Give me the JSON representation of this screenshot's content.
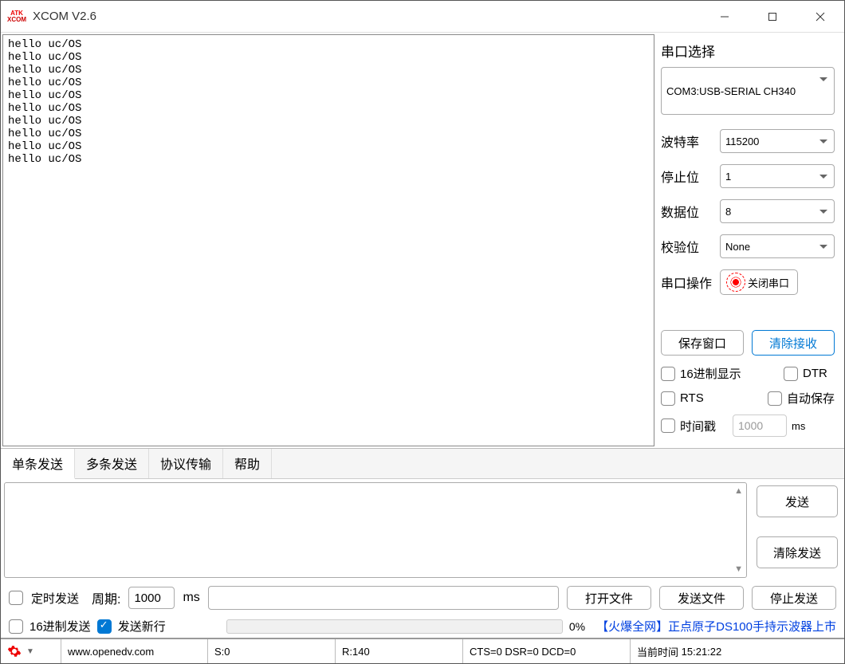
{
  "title": "XCOM V2.6",
  "logo": {
    "line1": "ATK",
    "line2": "XCOM"
  },
  "receive_lines": [
    "hello uc/OS",
    "hello uc/OS",
    "hello uc/OS",
    "hello uc/OS",
    "hello uc/OS",
    "hello uc/OS",
    "hello uc/OS",
    "hello uc/OS",
    "hello uc/OS",
    "hello uc/OS"
  ],
  "side": {
    "port_select_label": "串口选择",
    "port": "COM3:USB-SERIAL CH340",
    "baud_label": "波特率",
    "baud": "115200",
    "stop_label": "停止位",
    "stop": "1",
    "data_label": "数据位",
    "data": "8",
    "parity_label": "校验位",
    "parity": "None",
    "op_label": "串口操作",
    "op_btn": "关闭串口",
    "save_win": "保存窗口",
    "clear_recv": "清除接收",
    "hex_disp": "16进制显示",
    "dtr": "DTR",
    "rts": "RTS",
    "autosave": "自动保存",
    "ts": "时间戳",
    "ts_val": "1000",
    "ts_unit": "ms"
  },
  "tabs": {
    "t1": "单条发送",
    "t2": "多条发送",
    "t3": "协议传输",
    "t4": "帮助"
  },
  "sendbtns": {
    "send": "发送",
    "clear": "清除发送"
  },
  "mid": {
    "timed": "定时发送",
    "period_lbl": "周期:",
    "period": "1000",
    "unit": "ms",
    "open": "打开文件",
    "sendfile": "发送文件",
    "stop": "停止发送"
  },
  "row2": {
    "hexsend": "16进制发送",
    "newline": "发送新行",
    "pct": "0%",
    "promo": "【火爆全网】正点原子DS100手持示波器上市"
  },
  "status": {
    "url": "www.openedv.com",
    "s": "S:0",
    "r": "R:140",
    "sig": "CTS=0 DSR=0 DCD=0",
    "time_lbl": "当前时间",
    "time": "15:21:22"
  }
}
